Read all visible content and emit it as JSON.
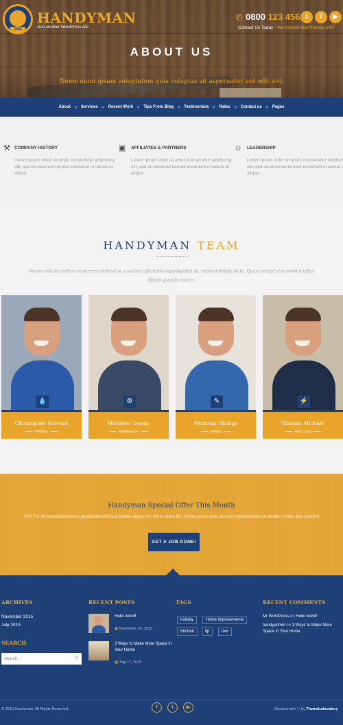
{
  "brand": {
    "name": "HANDYMAN",
    "tagline": "Just another WordPress site",
    "badge_year": "1988"
  },
  "header": {
    "phone_prefix": "0800",
    "phone_number": "123 456",
    "contact_label": "Contact Us Today",
    "contact_note": "- We Answer Our Phones 24/7",
    "social": [
      "twitter-icon",
      "facebook-icon",
      "youtube-icon"
    ]
  },
  "hero": {
    "title": "ABOUT US",
    "subtitle": "Nemo enim ipsam voluptatem quia voluptas sit aspernatur aut odit aut."
  },
  "nav": [
    "About",
    "Services",
    "Recent Work",
    "Tips From Blog",
    "Testimonials",
    "Rates",
    "Contact us",
    "Pages"
  ],
  "features": [
    {
      "icon": "tools-icon",
      "title": "COMPANY HISTORY",
      "text": "Lorem ipsum dolor sit amet, consectetur adipiscing elit, sed do eiusmod tempor incididunt ut labore et aliqua."
    },
    {
      "icon": "briefcase-icon",
      "title": "AFFILIATES & PARTNERS",
      "text": "Lorem ipsum dolor sit amet, consectetur adipiscing elit, sed do eiusmod tempor incididunt ut labore et aliqua."
    },
    {
      "icon": "user-icon",
      "title": "LEADERSHIP",
      "text": "Lorem ipsum dolor sit amet, consectetur adipiscing elit, sed do eiusmod tempor incididunt ut labore et aliqua."
    }
  ],
  "team": {
    "title_a": "HANDYMAN",
    "title_b": "TEAM",
    "subtitle": "Nostra ridiculus tellus meacenes eleifend at, conubia sollicitudin repodiandea sit, nostrud debitis dicta. Quasi preasesent porttitor tellus aliquid gravida mauris.",
    "members": [
      {
        "name": "Christopher Stevens",
        "role": "Plumber",
        "icon": "drop-icon",
        "bg": "#9aa8b8",
        "shirt": "#2a5aa8"
      },
      {
        "name": "Matthew Owens",
        "role": "Maintenance",
        "icon": "gears-icon",
        "bg": "#ded6c8",
        "shirt": "#3a4a66"
      },
      {
        "name": "Nicholas Phillips",
        "role": "Painter",
        "icon": "brush-icon",
        "bg": "#e6e2dc",
        "shirt": "#3469ad"
      },
      {
        "name": "Thomas Michael",
        "role": "Electrician",
        "icon": "plug-icon",
        "bg": "#c7bda9",
        "shirt": "#1f2d48"
      }
    ]
  },
  "offer": {
    "title": "Handyman Special Offer This Month",
    "text": "-20% For all cursusdignissimos perspiciatis dictmust beatea aliqua non minus etiam illo ultricies purus nulla faucibus reppesumbda for all tetur modes elus proident.",
    "button": "GET A JOB DONE!"
  },
  "footer": {
    "archives_title": "ARCHIVES",
    "archives": [
      "November 2015",
      "July 2015"
    ],
    "search_title": "SEARCH",
    "search_placeholder": "Search...",
    "posts_title": "RECENT POSTS",
    "posts": [
      {
        "title": "Hello world!",
        "date": "November 24, 2015"
      },
      {
        "title": "3 Ways to Make More Space in Your Home",
        "date": "July 17, 2015"
      }
    ],
    "tags_title": "TAGS",
    "tags": [
      "holiday",
      "Home improvements",
      "Kitchen",
      "tip",
      "tool"
    ],
    "comments_title": "RECENT COMMENTS",
    "comments": [
      {
        "author": "Mr WordPress",
        "on": "on",
        "post": "Hello world!"
      },
      {
        "author": "handyadmin",
        "on": "on",
        "post": "3 Ways to Make More Space in Your Home"
      }
    ],
    "copyright": "© 2015 Handyman. All Rights Reserved.",
    "credit_prefix": "Created with",
    "credit_by": "by",
    "credit_name": "ThemeLaboratory"
  },
  "colors": {
    "navy": "#1e4077",
    "accent": "#e8a52a"
  }
}
